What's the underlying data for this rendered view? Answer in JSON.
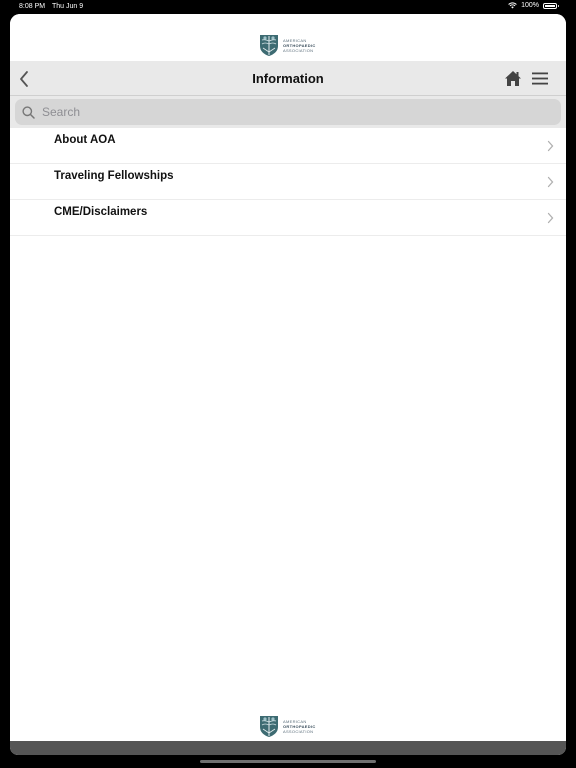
{
  "status_bar": {
    "time": "8:08 PM",
    "date": "Thu Jun 9",
    "battery": "100%",
    "battery_level": 1.0
  },
  "logo": {
    "line1": "AMERICAN",
    "line2": "ORTHOPAEDIC",
    "line3": "ASSOCIATION"
  },
  "nav": {
    "title": "Information",
    "back_icon": "chevron-left-icon",
    "home_icon": "home-icon",
    "menu_icon": "hamburger-menu-icon"
  },
  "search": {
    "placeholder": "Search",
    "value": ""
  },
  "list": {
    "items": [
      {
        "label": "About AOA"
      },
      {
        "label": "Traveling Fellowships"
      },
      {
        "label": "CME/Disclaimers"
      }
    ]
  },
  "colors": {
    "nav_background": "#e9e9e9",
    "search_field": "#d6d6d6",
    "text": "#111111",
    "chevron": "#b0b0b0",
    "logo_teal": "#3d6b72"
  }
}
